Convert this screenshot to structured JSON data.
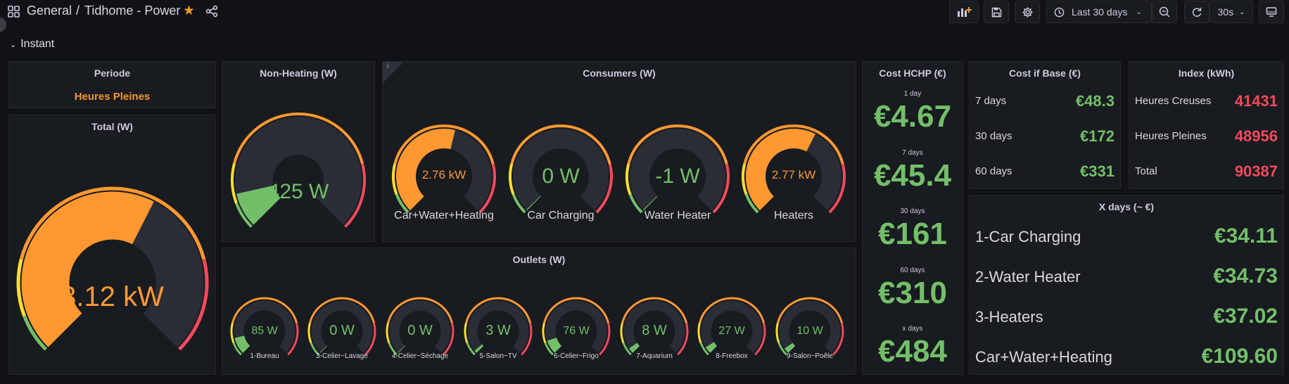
{
  "header": {
    "folder": "General",
    "separator": "/",
    "dashboard_title": "Tidhome - Power",
    "time_range": "Last 30 days",
    "refresh_interval": "30s"
  },
  "row": {
    "title": "Instant"
  },
  "periode": {
    "title": "Periode",
    "value": "Heures Pleines",
    "color": "#f2962e"
  },
  "total": {
    "title": "Total (W)",
    "value": "3.12 kW",
    "fraction": 0.6,
    "color": "#ff9830"
  },
  "nonheating": {
    "title": "Non-Heating (W)",
    "value": "425 W",
    "fraction": 0.12,
    "color": "#73bf69"
  },
  "consumers": {
    "title": "Consumers (W)",
    "info": "i",
    "gauges": [
      {
        "label": "Car+Water+Heating",
        "value": "2.76 kW",
        "fraction": 0.55,
        "color": "#ff9830",
        "size": "small"
      },
      {
        "label": "Car Charging",
        "value": "0 W",
        "fraction": 0,
        "color": "#73bf69",
        "size": "big"
      },
      {
        "label": "Water Heater",
        "value": "-1 W",
        "fraction": 0,
        "color": "#73bf69",
        "size": "big"
      },
      {
        "label": "Heaters",
        "value": "2.77 kW",
        "fraction": 0.6,
        "color": "#ff9830",
        "size": "small"
      }
    ]
  },
  "outlets": {
    "title": "Outlets (W)",
    "gauges": [
      {
        "label": "1-Bureau",
        "value": "85 W",
        "fraction": 0.12
      },
      {
        "label": "3-Celier~Lavage",
        "value": "0 W",
        "fraction": 0
      },
      {
        "label": "4-Celier~Séchage",
        "value": "0 W",
        "fraction": 0
      },
      {
        "label": "5-Salon~TV",
        "value": "3 W",
        "fraction": 0.02
      },
      {
        "label": "6-Celier~Frigo",
        "value": "76 W",
        "fraction": 0.1
      },
      {
        "label": "7-Aquarium",
        "value": "8 W",
        "fraction": 0.04
      },
      {
        "label": "8-Freebox",
        "value": "27 W",
        "fraction": 0.05
      },
      {
        "label": "9-Salon~Poêle",
        "value": "10 W",
        "fraction": 0.04
      }
    ]
  },
  "cost_hchp": {
    "title": "Cost HCHP (€)",
    "items": [
      {
        "label": "1 day",
        "value": "€4.67"
      },
      {
        "label": "7 days",
        "value": "€45.4"
      },
      {
        "label": "30 days",
        "value": "€161"
      },
      {
        "label": "60 days",
        "value": "€310"
      },
      {
        "label": "x days",
        "value": "€484"
      }
    ]
  },
  "cost_base": {
    "title": "Cost if Base (€)",
    "items": [
      {
        "label": "7 days",
        "value": "€48.3"
      },
      {
        "label": "30 days",
        "value": "€172"
      },
      {
        "label": "60 days",
        "value": "€331"
      }
    ]
  },
  "index": {
    "title": "Index (kWh)",
    "items": [
      {
        "label": "Heures Creuses",
        "value": "41431"
      },
      {
        "label": "Heures Pleines",
        "value": "48956"
      },
      {
        "label": "Total",
        "value": "90387"
      }
    ]
  },
  "xdays": {
    "title": "X days (~ €)",
    "items": [
      {
        "label": "1-Car Charging",
        "value": "€34.11"
      },
      {
        "label": "2-Water Heater",
        "value": "€34.73"
      },
      {
        "label": "3-Heaters",
        "value": "€37.02"
      },
      {
        "label": "Car+Water+Heating",
        "value": "€109.60"
      }
    ]
  },
  "colors": {
    "green": "#73bf69",
    "orange": "#ff9830",
    "red": "#f2495c",
    "yellow": "#fade2a",
    "panel_bg": "#181b1f",
    "page_bg": "#111217"
  }
}
